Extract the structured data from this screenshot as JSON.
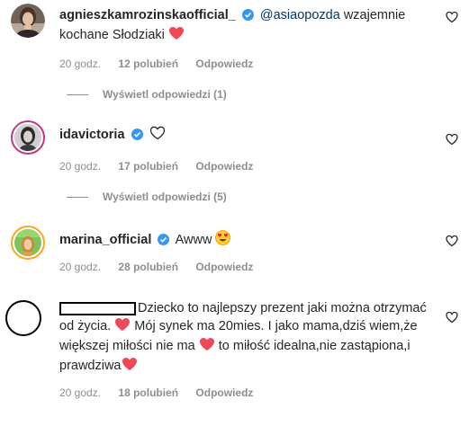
{
  "comments": [
    {
      "username": "agnieszkamrozinskaofficial_",
      "mention": "@asiaopozda",
      "text": "wzajemnie kochane Słodziaki",
      "time": "20 godz.",
      "likes": "12 polubień",
      "reply": "Odpowiedz",
      "view_replies": "Wyświetl odpowiedzi (1)"
    },
    {
      "username": "idavictoria",
      "text": "",
      "time": "20 godz.",
      "likes": "17 polubień",
      "reply": "Odpowiedz",
      "view_replies": "Wyświetl odpowiedzi (5)"
    },
    {
      "username": "marina_official",
      "text": "Awww",
      "time": "20 godz.",
      "likes": "28 polubień",
      "reply": "Odpowiedz"
    },
    {
      "username": "",
      "text_part1": "Dziecko to najlepszy prezent jaki można otrzymać od życia.",
      "text_part2": "Mój synek ma 20mies. I jako mama,dziś wiem,że większej miłości nie ma",
      "text_part3": "to miłość idealna,nie zastąpiona,i prawdziwa",
      "time": "20 godz.",
      "likes": "18 polubień",
      "reply": "Odpowiedz"
    }
  ],
  "colors": {
    "heart": "#ed4956",
    "verified": "#3897f0",
    "meta": "#8e8e8e",
    "mention": "#00376b"
  },
  "icons": {
    "like": "heart-outline-icon",
    "verified": "verified-badge-icon",
    "heart": "red-heart-emoji-icon",
    "heart_eyes": "heart-eyes-emoji-icon"
  }
}
